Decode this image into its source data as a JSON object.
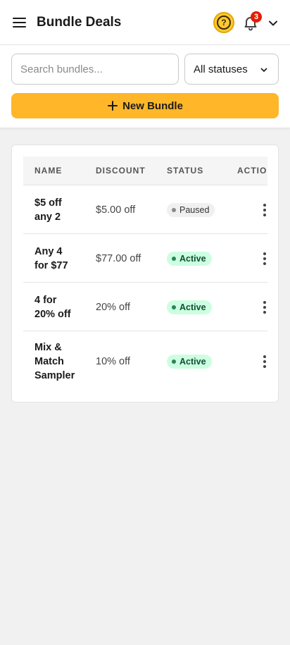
{
  "header": {
    "title": "Bundle Deals",
    "help_icon": "question-icon",
    "help_glyph": "?",
    "notifications_count": "3"
  },
  "filters": {
    "search_placeholder": "Search bundles...",
    "search_value": "",
    "status_selected": "All statuses",
    "new_button_label": "New Bundle"
  },
  "table": {
    "columns": [
      "Name",
      "Discount",
      "Status",
      "Actions"
    ],
    "rows": [
      {
        "name": "$5 off any 2",
        "discount": "$5.00 off",
        "status": "Paused"
      },
      {
        "name": "Any 4 for $77",
        "discount": "$77.00 off",
        "status": "Active"
      },
      {
        "name": "4 for 20% off",
        "discount": "20% off",
        "status": "Active"
      },
      {
        "name": "Mix & Match Sampler",
        "discount": "10% off",
        "status": "Active"
      }
    ]
  },
  "colors": {
    "accent": "#ffb629",
    "active_badge_bg": "#cdfee1",
    "active_badge_text": "#0c5132",
    "paused_badge_bg": "#f0f0f0",
    "notification_badge": "#e51c00"
  }
}
